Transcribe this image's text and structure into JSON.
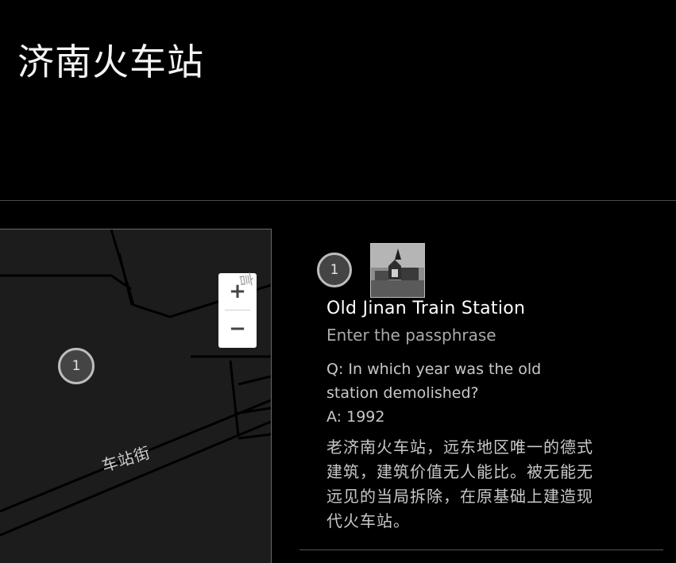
{
  "page": {
    "title": "济南火车站"
  },
  "map": {
    "zoom_in_label": "+",
    "zoom_out_label": "−",
    "marker_number": "1",
    "street_label": "车站街",
    "street_label_partial": "言"
  },
  "poi": {
    "marker_number": "1",
    "title": "Old Jinan Train Station",
    "passphrase_prompt": "Enter the passphrase",
    "question": "Q: In which year was the old station demolished?",
    "answer": "A: 1992",
    "description": "老济南火车站，远东地区唯一的德式建筑，建筑价值无人能比。被无能无远见的当局拆除，在原基础上建造现代火车站。",
    "thumbnail_icon": "station-photo-icon"
  },
  "colors": {
    "background": "#000000",
    "map_background": "#1c1c1c",
    "marker_fill": "#444444",
    "marker_border": "#bdbdbd"
  }
}
